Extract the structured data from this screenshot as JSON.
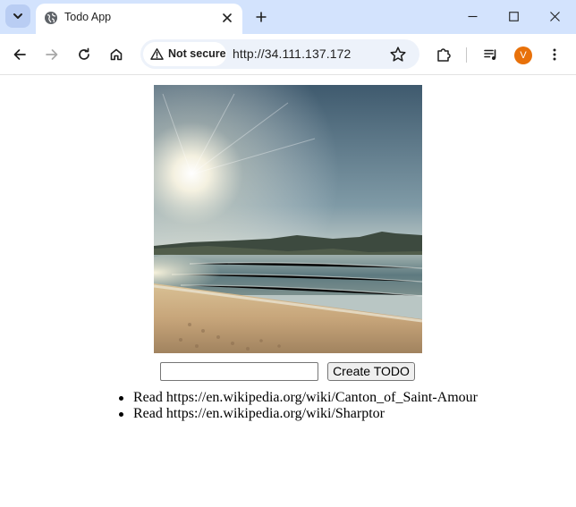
{
  "tab": {
    "title": "Todo App"
  },
  "omnibox": {
    "security_label": "Not secure",
    "url": "http://34.111.137.172"
  },
  "profile": {
    "initial": "V",
    "color": "#e8710a"
  },
  "todo": {
    "input_value": "",
    "create_button_label": "Create TODO",
    "items": [
      {
        "text": "Read https://en.wikipedia.org/wiki/Canton_of_Saint-Amour"
      },
      {
        "text": "Read https://en.wikipedia.org/wiki/Sharptor"
      }
    ]
  },
  "icons": {
    "tab_search": "chevron-down-icon",
    "favicon": "globe-icon",
    "tab_close": "close-icon",
    "new_tab": "plus-icon",
    "minimize": "minimize-icon",
    "maximize": "maximize-icon",
    "close": "window-close-icon",
    "back": "arrow-left-icon",
    "forward": "arrow-right-icon",
    "reload": "reload-icon",
    "home": "home-icon",
    "security": "warning-triangle-icon",
    "bookmark": "star-icon",
    "extensions": "puzzle-icon",
    "media": "media-queue-icon",
    "menu": "kebab-menu-icon"
  }
}
